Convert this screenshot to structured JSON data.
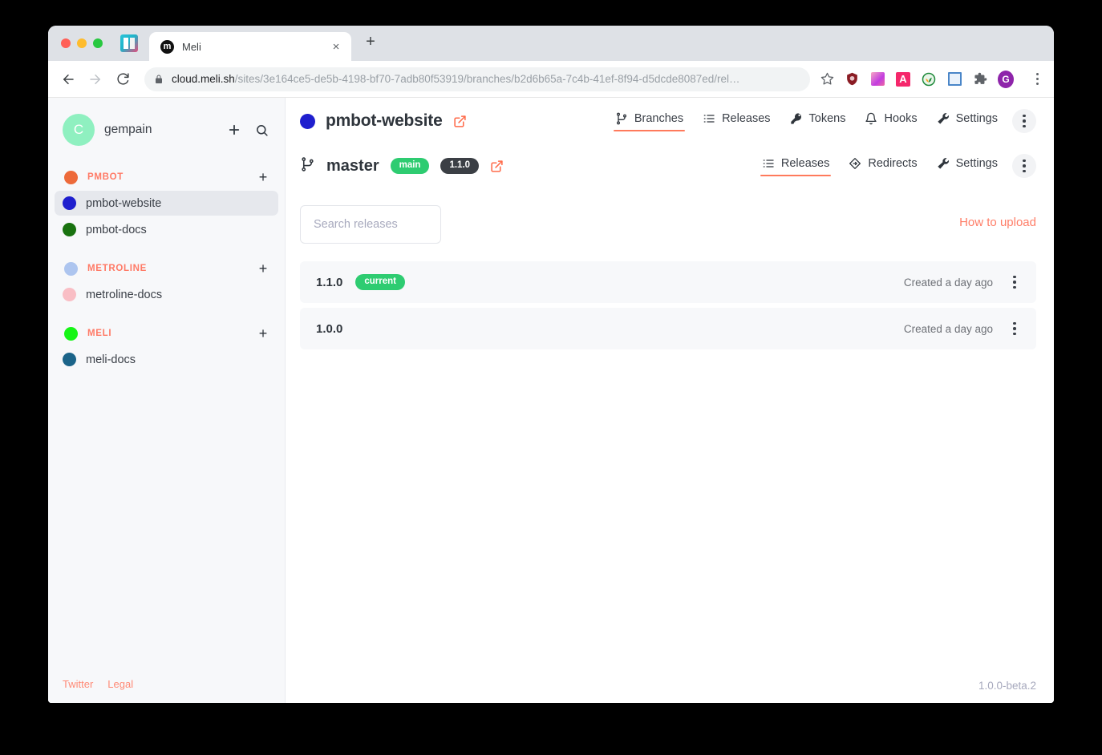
{
  "browser": {
    "tab": {
      "title": "Meli",
      "favicon_letter": "m",
      "close_label": "×"
    },
    "new_tab_label": "+",
    "url_host": "cloud.meli.sh",
    "url_path": "/sites/3e164ce5-de5b-4198-bf70-7adb80f53919/branches/b2d6b65a-7c4b-41ef-8f94-d5dcde8087ed/rel…",
    "extensions": {
      "letter_a": "A",
      "profile_letter": "G"
    }
  },
  "sidebar": {
    "account": {
      "avatar_letter": "C",
      "avatar_color": "#8ff0c0",
      "username": "gempain"
    },
    "add_label": "+",
    "groups": [
      {
        "name": "PMBOT",
        "color": "#ed6a3a",
        "add_label": "+",
        "sites": [
          {
            "label": "pmbot-website",
            "color": "#1f1fce",
            "active": true
          },
          {
            "label": "pmbot-docs",
            "color": "#19720f",
            "active": false
          }
        ]
      },
      {
        "name": "METROLINE",
        "color": "#adc5ef",
        "add_label": "+",
        "sites": [
          {
            "label": "metroline-docs",
            "color": "#f9bec5",
            "active": false
          }
        ]
      },
      {
        "name": "MELI",
        "color": "#16f516",
        "add_label": "+",
        "sites": [
          {
            "label": "meli-docs",
            "color": "#1b6489",
            "active": false
          }
        ]
      }
    ],
    "footer": {
      "twitter": "Twitter",
      "legal": "Legal"
    }
  },
  "site_header": {
    "bullet_color": "#1f1fce",
    "title": "pmbot-website",
    "nav": [
      {
        "label": "Branches",
        "icon": "branch-icon",
        "active": true
      },
      {
        "label": "Releases",
        "icon": "list-icon",
        "active": false
      },
      {
        "label": "Tokens",
        "icon": "key-icon",
        "active": false
      },
      {
        "label": "Hooks",
        "icon": "bell-icon",
        "active": false
      },
      {
        "label": "Settings",
        "icon": "wrench-icon",
        "active": false
      }
    ]
  },
  "branch_header": {
    "name": "master",
    "badge_main": "main",
    "badge_version": "1.1.0",
    "nav": [
      {
        "label": "Releases",
        "icon": "list-icon",
        "active": true
      },
      {
        "label": "Redirects",
        "icon": "redirect-icon",
        "active": false
      },
      {
        "label": "Settings",
        "icon": "wrench-icon",
        "active": false
      }
    ]
  },
  "content": {
    "search_placeholder": "Search releases",
    "search_value": "",
    "how_to_upload": "How to upload",
    "releases": [
      {
        "version": "1.1.0",
        "badge": "current",
        "created": "Created a day ago"
      },
      {
        "version": "1.0.0",
        "badge": "",
        "created": "Created a day ago"
      }
    ]
  },
  "footer": {
    "version": "1.0.0-beta.2"
  },
  "colors": {
    "accent": "#ff7a5c",
    "green": "#2ecc71",
    "dark": "#3b3f45"
  }
}
